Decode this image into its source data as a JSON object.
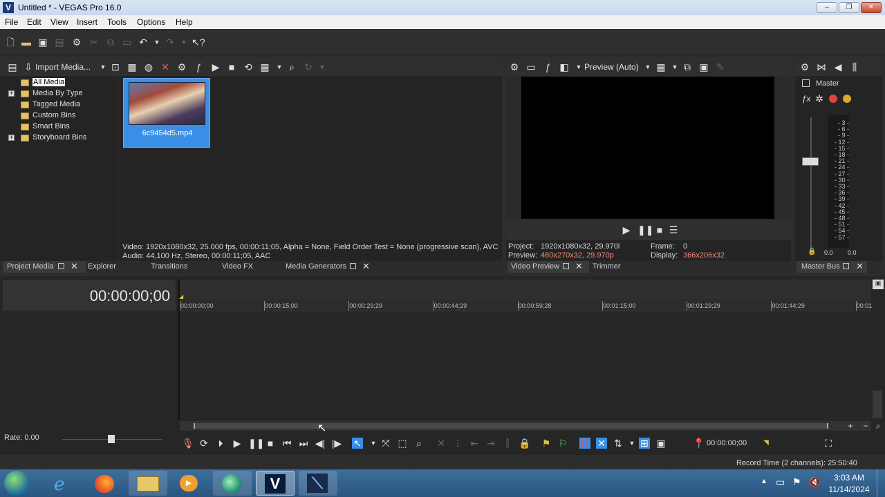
{
  "window": {
    "title": "Untitled * - VEGAS Pro 16.0",
    "app_icon": "V",
    "minimize_glyph": "–",
    "maximize_glyph": "❐",
    "close_glyph": "✕"
  },
  "menu": [
    "File",
    "Edit",
    "View",
    "Insert",
    "Tools",
    "Options",
    "Help"
  ],
  "media_panel": {
    "import_label": "Import Media...",
    "tree": [
      {
        "label": "All Media",
        "selected": true,
        "expandable": false
      },
      {
        "label": "Media By Type",
        "expandable": true
      },
      {
        "label": "Tagged Media",
        "expandable": false
      },
      {
        "label": "Custom Bins",
        "expandable": false
      },
      {
        "label": "Smart Bins",
        "expandable": false
      },
      {
        "label": "Storyboard Bins",
        "expandable": true
      }
    ],
    "thumbnail_label": "6c9454d5.mp4",
    "info_video": "Video: 1920x1080x32, 25.000 fps, 00:00:11;05, Alpha = None, Field Order Test = None (progressive scan), AVC",
    "info_audio": "Audio: 44,100 Hz, Stereo, 00:00:11;05, AAC",
    "tabs": [
      "Project Media",
      "Explorer",
      "Transitions",
      "Video FX",
      "Media Generators"
    ]
  },
  "preview_panel": {
    "mode_label": "Preview (Auto)",
    "project_label": "Project:",
    "project_value": "1920x1080x32, 29.970i",
    "preview_label": "Preview:",
    "preview_value": "480x270x32, 29.970p",
    "frame_label": "Frame:",
    "frame_value": "0",
    "display_label": "Display:",
    "display_value": "366x206x32",
    "tabs": [
      "Video Preview",
      "Trimmer"
    ]
  },
  "master_panel": {
    "title": "Master",
    "scale": [
      "3",
      "6",
      "9",
      "12",
      "15",
      "18",
      "21",
      "24",
      "27",
      "30",
      "33",
      "36",
      "39",
      "42",
      "45",
      "48",
      "51",
      "54",
      "57"
    ],
    "peak_left": "0.0",
    "peak_right": "0.0",
    "tab": "Master Bus"
  },
  "timeline": {
    "timecode": "00:00:00;00",
    "ruler": [
      "00:00:00;00",
      "00:00:15;00",
      "00:00:29;29",
      "00:00:44;29",
      "00:00:59;28",
      "00:01:15;00",
      "00:01:29;29",
      "00:01:44;29",
      "00:01"
    ],
    "rate_label": "Rate: 0.00",
    "cursor_time": "00:00:00;00",
    "record_time": "Record Time (2 channels): 25:50:40"
  },
  "taskbar": {
    "clock_time": "3:03 AM",
    "clock_date": "11/14/2024",
    "apps": [
      "ie",
      "firefox",
      "explorer",
      "media-player",
      "browser",
      "vegas",
      "vegas-secondary"
    ]
  },
  "colors": {
    "accent": "#3a8ee6",
    "preview_value_color": "#f08a7a",
    "panel_bg": "#242424",
    "toolbar_bg": "#2f2f2f"
  }
}
